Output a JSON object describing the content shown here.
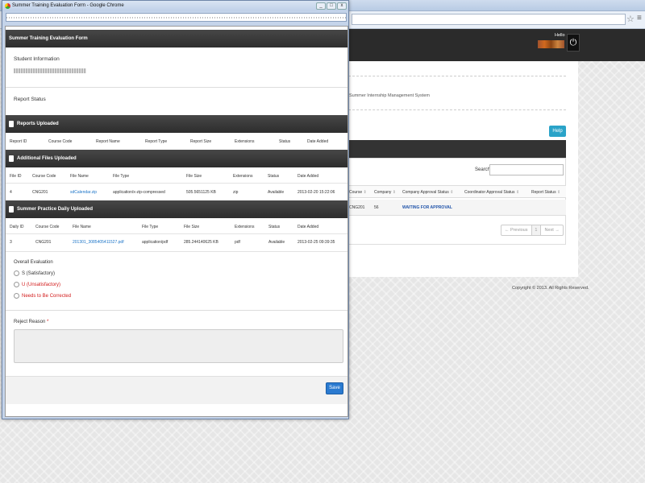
{
  "bg": {
    "hello": "Hello",
    "system_name": "Summer Internship Management System",
    "help": "Help",
    "search_label": "Search:",
    "columns": [
      "Course",
      "Company",
      "Company Approval Status",
      "Coordinator Approval Status",
      "Report Status"
    ],
    "row": {
      "course": "CNG201",
      "company": "56",
      "company_status": "WAITING FOR APPROVAL"
    },
    "pager": {
      "previous": "← Previous",
      "page": "1",
      "next": "Next →"
    },
    "copyright": "Copyright © 2013. All Rights Reserved."
  },
  "window": {
    "title": "Summer Training Evaluation Form - Google Chrome",
    "minimize": "_",
    "maximize": "□",
    "close": "x"
  },
  "form": {
    "header": "Summer Training Evaluation Form",
    "student_info_label": "Student Information",
    "report_status_label": "Report Status",
    "reports": {
      "title": "Reports Uploaded",
      "columns": [
        "Report ID",
        "Course Code",
        "Report Name",
        "Report Type",
        "Report Size",
        "Extensions",
        "Status",
        "Date Added"
      ]
    },
    "files": {
      "title": "Additional Files Uploaded",
      "columns": [
        "File ID",
        "Course Code",
        "File Name",
        "File Type",
        "File Size",
        "Extensions",
        "Status",
        "Date Added"
      ],
      "rows": [
        [
          "4",
          "CNG201",
          "sdCalendar.zip",
          "application/x-zip-compressed",
          "505.5651125 KB",
          "zip",
          "Available",
          "2013-02-20 15:22:06"
        ]
      ]
    },
    "daily": {
      "title": "Summer Practice Daily Uploaded",
      "columns": [
        "Daily ID",
        "Course Code",
        "File Name",
        "File Type",
        "File Size",
        "Extensions",
        "Status",
        "Date Added"
      ],
      "rows": [
        [
          "3",
          "CNG201",
          "201301_3085405411527.pdf",
          "application/pdf",
          "285.244140625 KB",
          "pdf",
          "Available",
          "2013-02-25 09:39:35"
        ]
      ]
    },
    "evaluation": {
      "label": "Overall Evaluation",
      "options": [
        "S (Satisfactory)",
        "U (Unsatisfactory)",
        "Needs to Be Corrected"
      ]
    },
    "reject_label": "Reject Reason",
    "required_mark": "*",
    "save": "Save"
  },
  "colors": {
    "accent": "#2a7ad0",
    "help": "#2aa3c8",
    "error": "#d21a1a",
    "link": "#1a73c7"
  }
}
